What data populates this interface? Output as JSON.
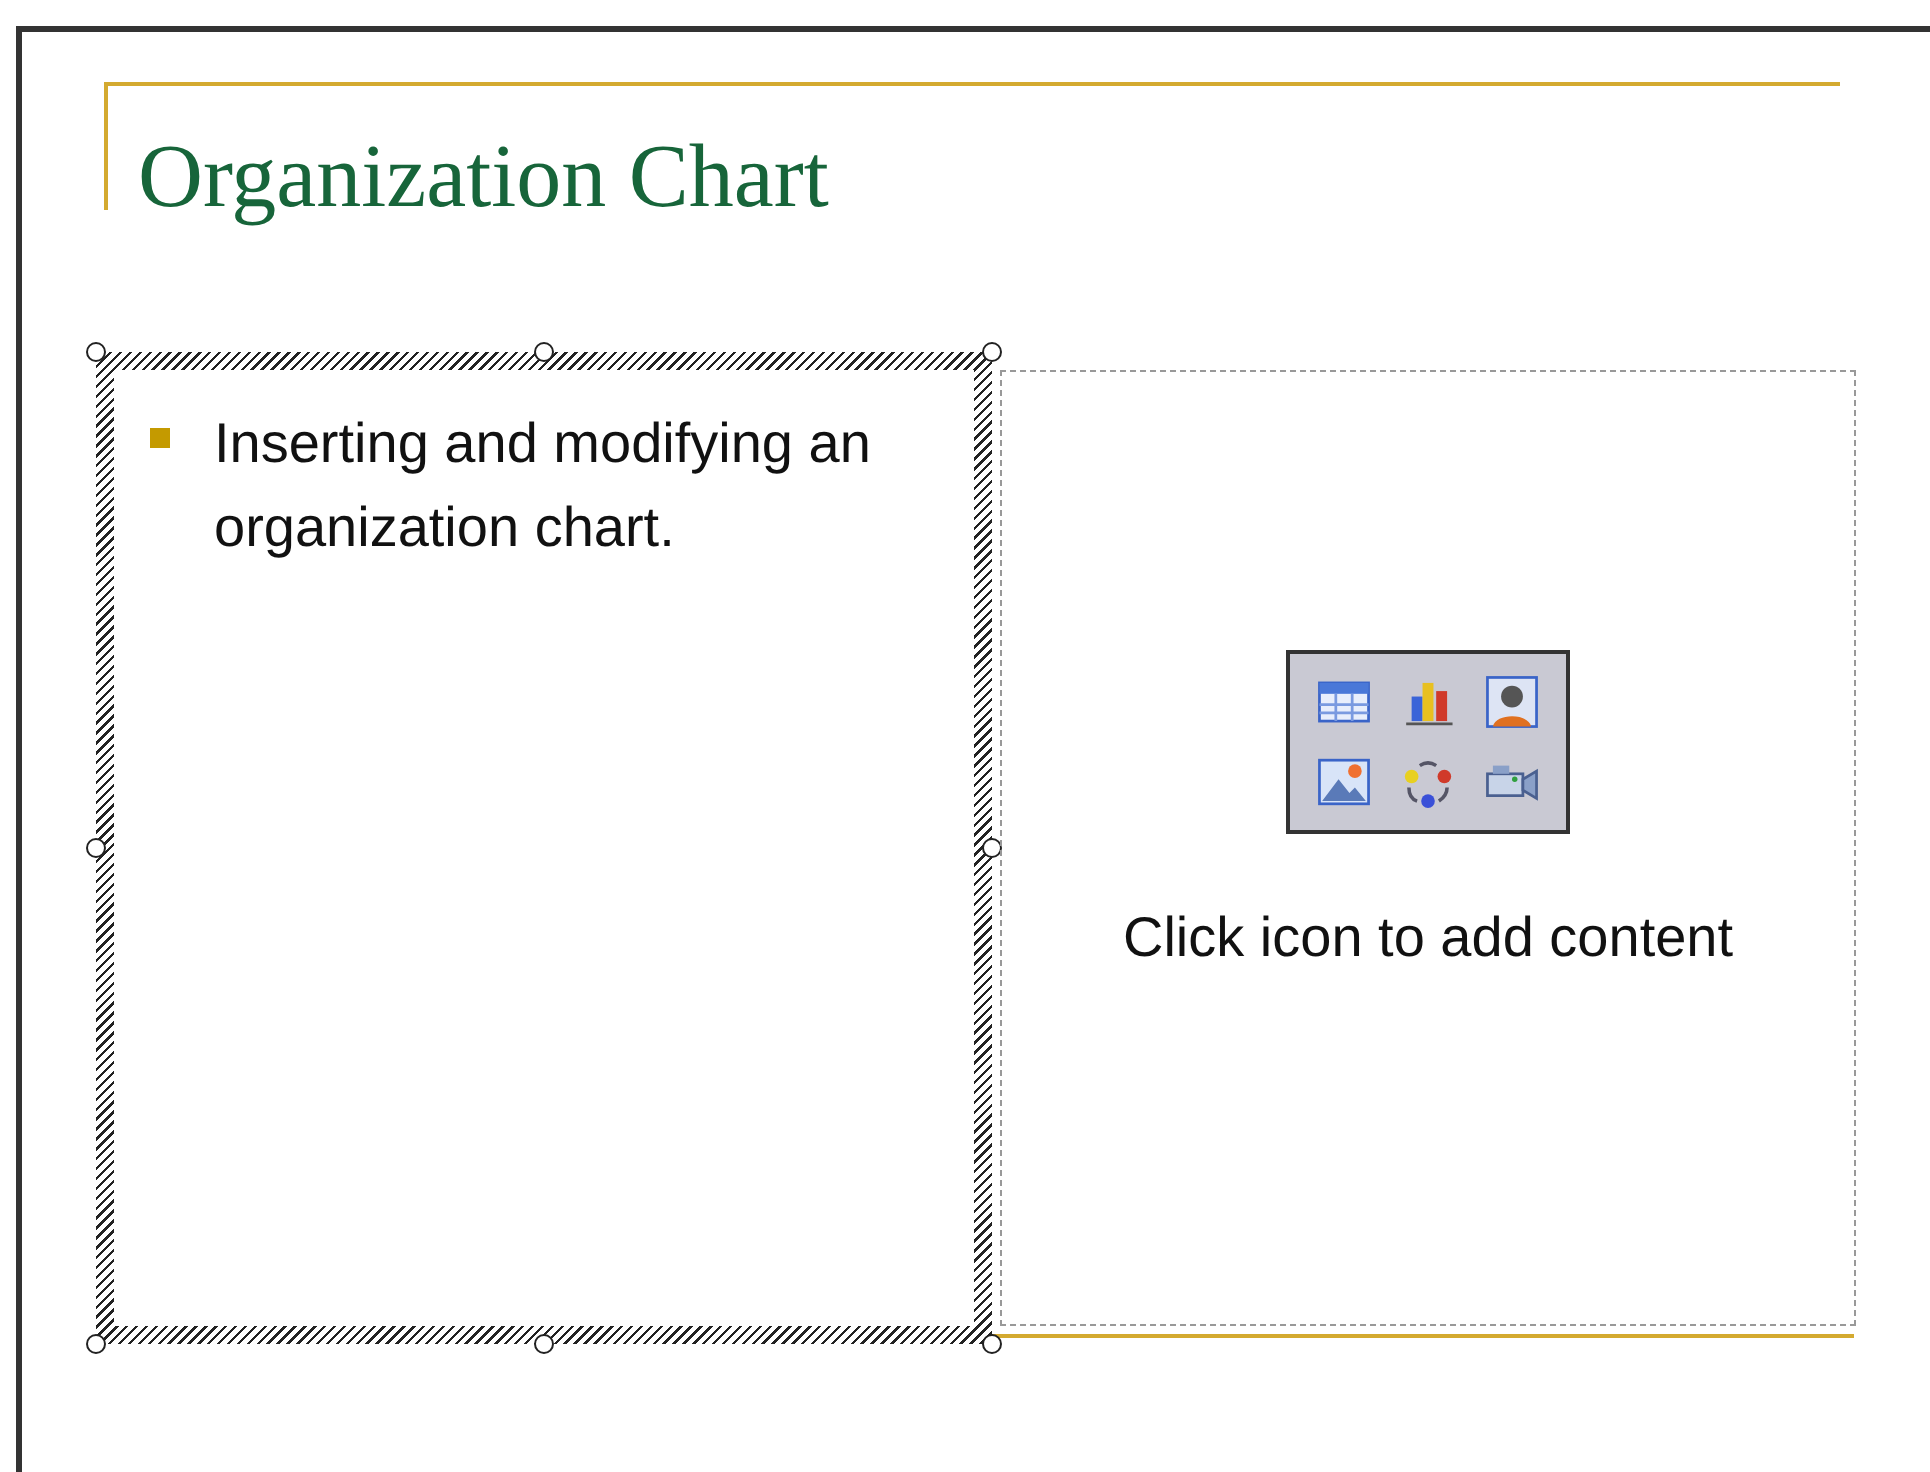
{
  "slide": {
    "title": "Organization Chart",
    "placeholders": [
      {
        "kind": "text",
        "selected": true,
        "bullets": [
          "Inserting and modifying an organization chart."
        ]
      },
      {
        "kind": "content",
        "selected": false,
        "hint": "Click icon to add content"
      }
    ]
  }
}
